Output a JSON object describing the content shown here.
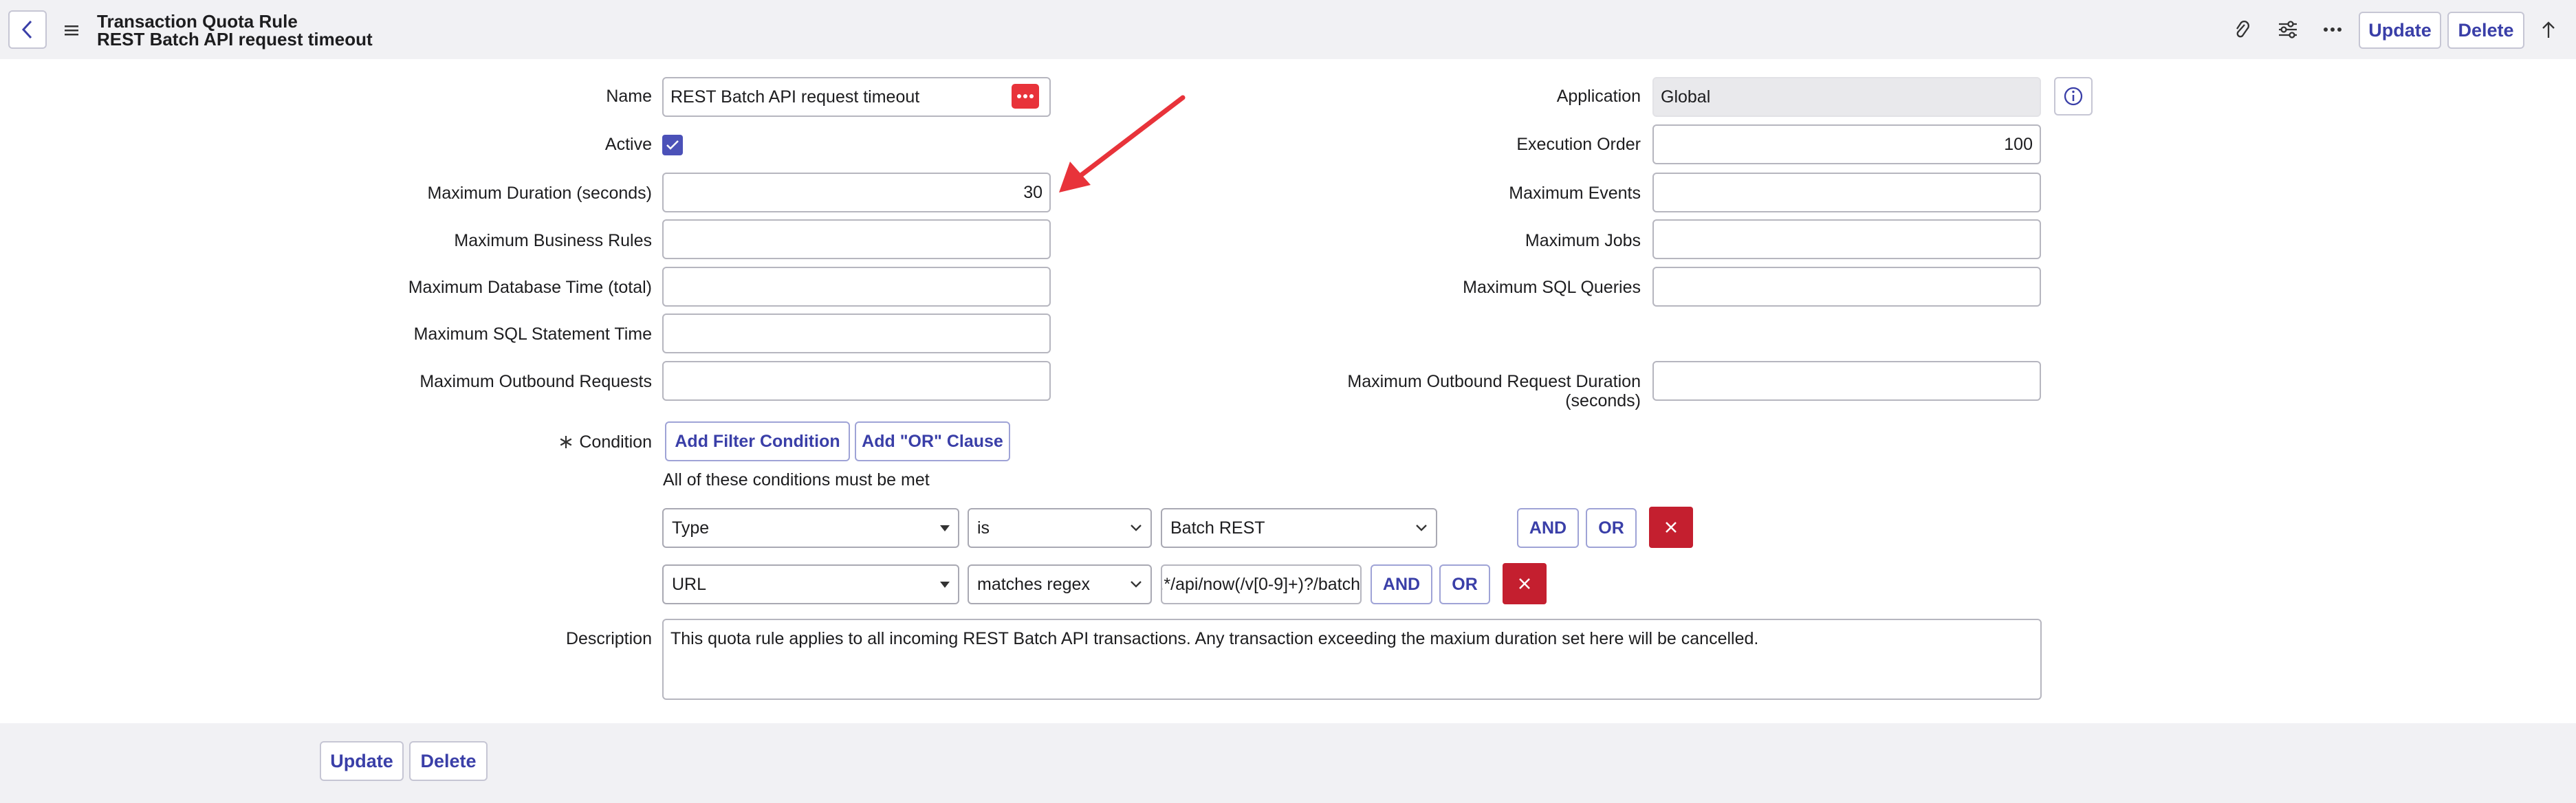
{
  "header": {
    "title": "Transaction Quota Rule",
    "subtitle": "REST Batch API request timeout",
    "update_label": "Update",
    "delete_label": "Delete"
  },
  "form": {
    "name": {
      "label": "Name",
      "value": "REST Batch API request timeout"
    },
    "active": {
      "label": "Active",
      "checked": true
    },
    "max_duration": {
      "label": "Maximum Duration (seconds)",
      "value": "30"
    },
    "max_business_rules": {
      "label": "Maximum Business Rules",
      "value": ""
    },
    "max_db_time": {
      "label": "Maximum Database Time (total)",
      "value": ""
    },
    "max_sql_stmt_time": {
      "label": "Maximum SQL Statement Time",
      "value": ""
    },
    "max_outbound_requests": {
      "label": "Maximum Outbound Requests",
      "value": ""
    },
    "application": {
      "label": "Application",
      "value": "Global"
    },
    "execution_order": {
      "label": "Execution Order",
      "value": "100"
    },
    "max_events": {
      "label": "Maximum Events",
      "value": ""
    },
    "max_jobs": {
      "label": "Maximum Jobs",
      "value": ""
    },
    "max_sql_queries": {
      "label": "Maximum SQL Queries",
      "value": ""
    },
    "max_outbound_duration": {
      "label_line1": "Maximum Outbound Request Duration",
      "label_line2": "(seconds)",
      "value": ""
    },
    "condition": {
      "label": "Condition",
      "add_filter_label": "Add Filter Condition",
      "add_or_label": "Add \"OR\" Clause",
      "hint": "All of these conditions must be met",
      "and_label": "AND",
      "or_label": "OR",
      "rows": [
        {
          "field": "Type",
          "operator": "is",
          "value": "Batch REST"
        },
        {
          "field": "URL",
          "operator": "matches regex",
          "value": ".*/api/now(/v[0-9]+)?/batch"
        }
      ]
    },
    "description": {
      "label": "Description",
      "value": "This quota rule applies to all incoming REST Batch API transactions. Any transaction exceeding the maxium duration set here will be cancelled."
    }
  },
  "footer": {
    "update_label": "Update",
    "delete_label": "Delete"
  },
  "colors": {
    "accent": "#3a3fa8",
    "danger": "#c41f2f",
    "annotation": "#e8333a",
    "header_bg": "#f1f1f4"
  }
}
